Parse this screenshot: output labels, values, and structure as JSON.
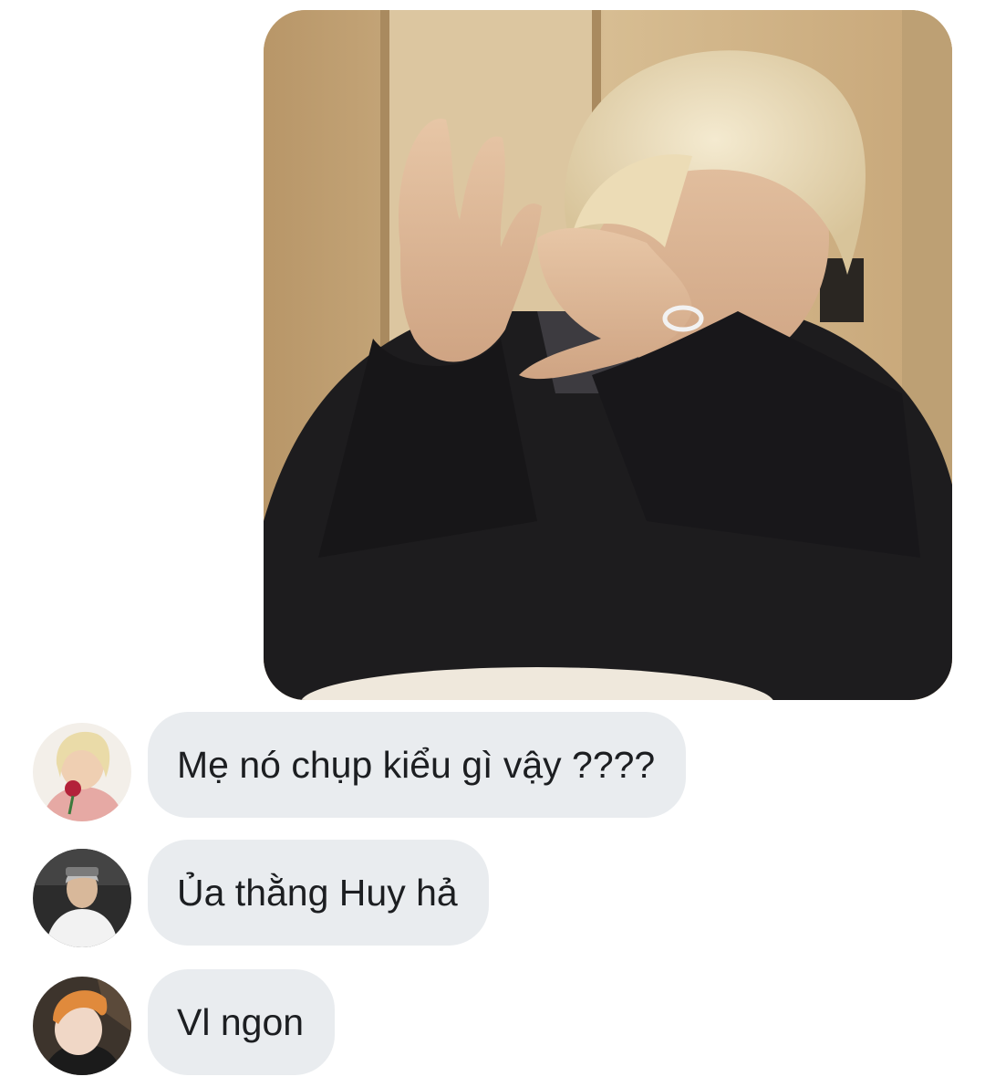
{
  "conversation": {
    "photo_message": {
      "icon": "photo-image",
      "description_hidden": true
    },
    "messages": [
      {
        "text": "Mẹ nó chụp kiểu gì vậy ????",
        "avatar_icon": "avatar-blonde-with-rose"
      },
      {
        "text": "Ủa thằng Huy hả",
        "avatar_icon": "avatar-white-outfit"
      },
      {
        "text": "Vl ngon",
        "avatar_icon": "avatar-orange-hair"
      }
    ]
  },
  "colors": {
    "bubble_background": "#e9ecef",
    "bubble_text": "#1c1e21",
    "page_background": "#ffffff"
  }
}
